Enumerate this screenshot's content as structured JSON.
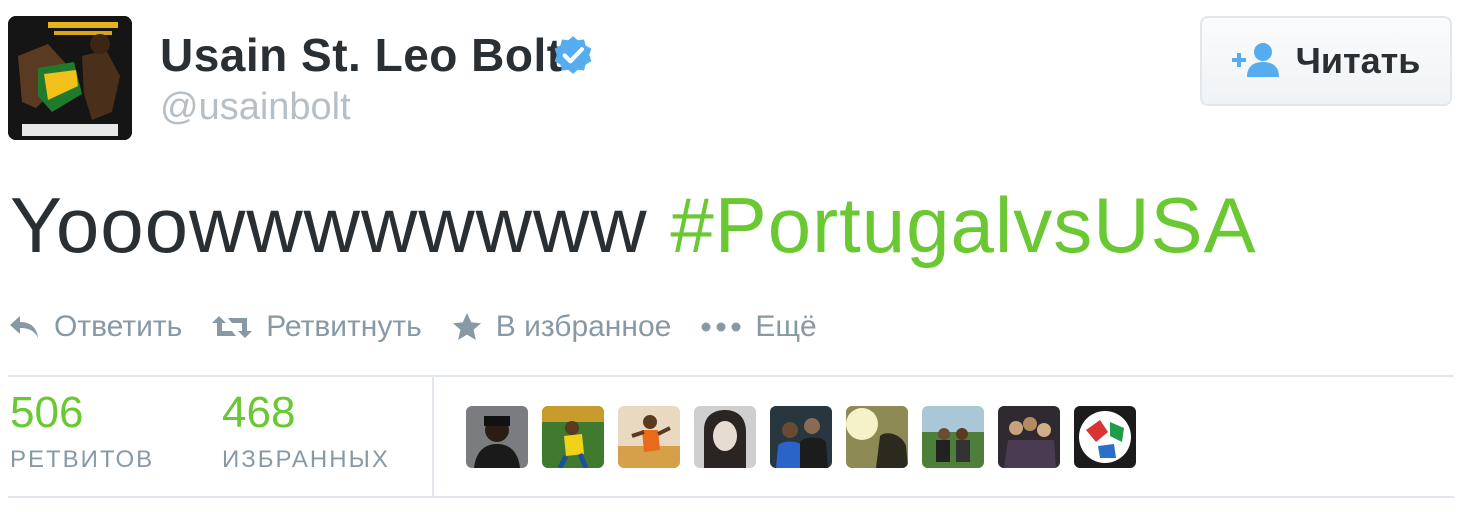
{
  "user": {
    "name": "Usain St. Leo Bolt",
    "screen_name": "@usainbolt",
    "verified": true
  },
  "follow_button": {
    "label": "Читать",
    "icon": "follow-user-plus-icon"
  },
  "tweet": {
    "text_plain": "Yooowwwwwwww",
    "hashtag": "#PortugalvsUSA"
  },
  "actions": [
    {
      "label": "Ответить",
      "icon": "reply-icon"
    },
    {
      "label": "Ретвитнуть",
      "icon": "retweet-icon"
    },
    {
      "label": "В избранное",
      "icon": "star-icon"
    },
    {
      "label": "Ещё",
      "icon": "more-dots-icon"
    }
  ],
  "stats": {
    "retweets": {
      "value": "506",
      "label": "РЕТВИТОВ"
    },
    "favorites": {
      "value": "468",
      "label": "ИЗБРАННЫХ"
    }
  },
  "colors": {
    "hashtag": "#6ac832",
    "verified": "#55acee",
    "follow_icon": "#55acee",
    "muted": "#8899a6"
  }
}
